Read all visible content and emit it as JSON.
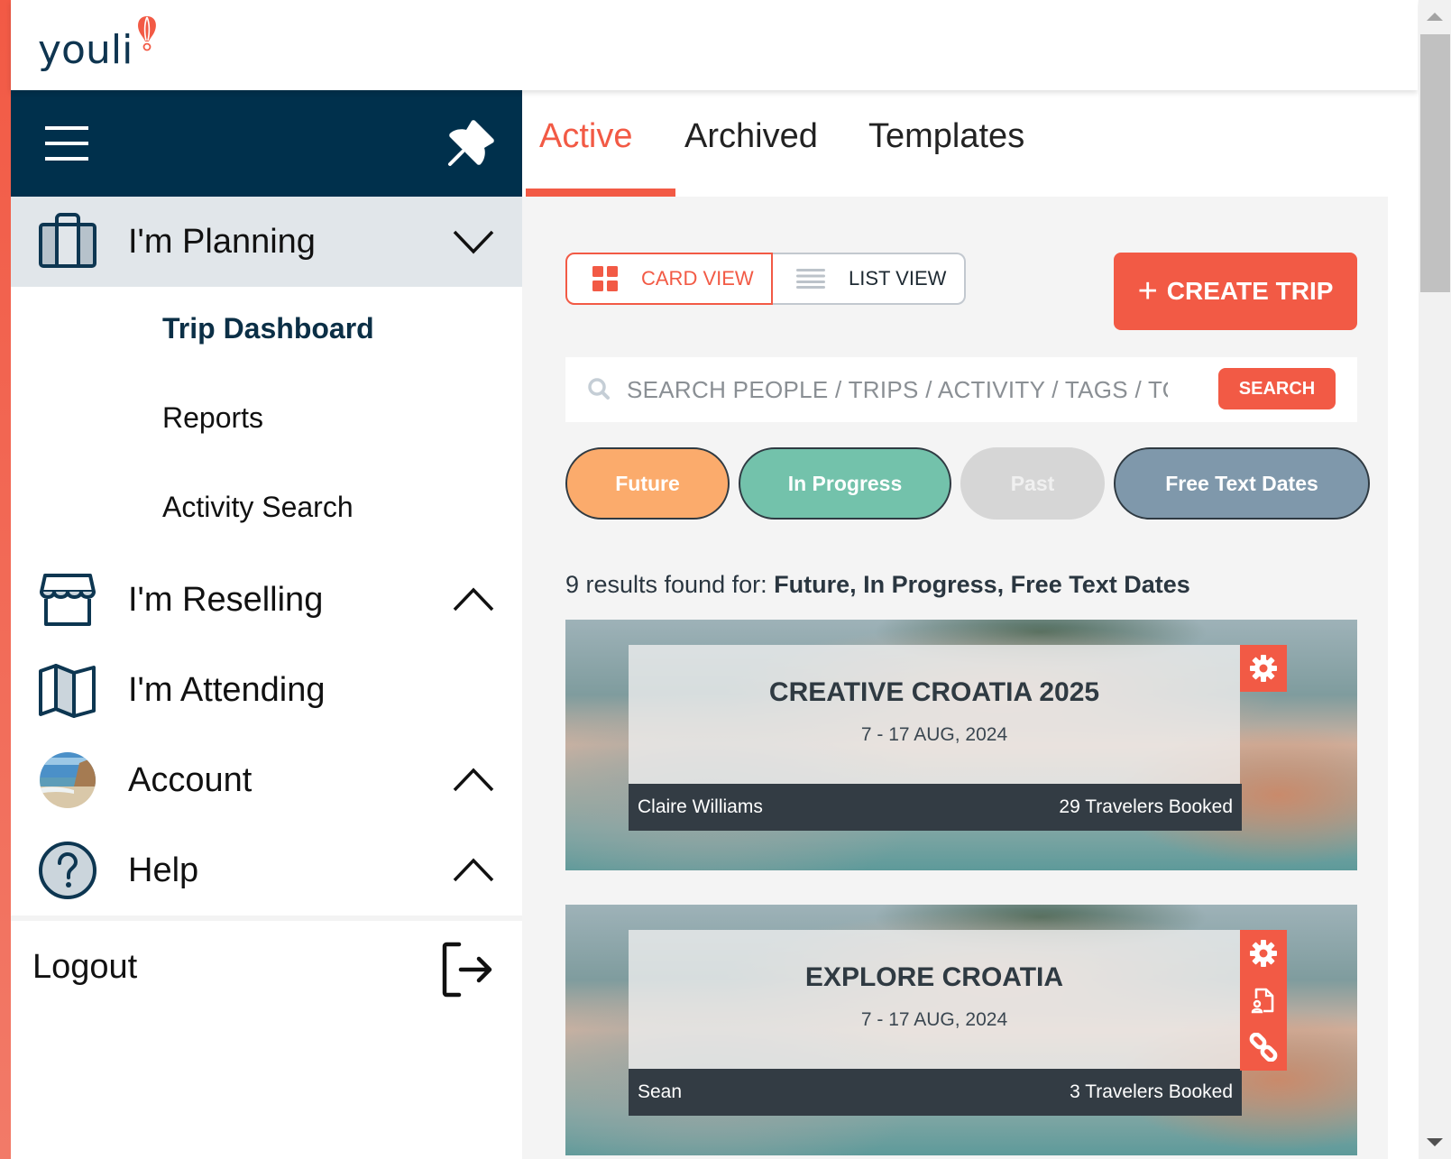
{
  "app": {
    "logo_text": "youli"
  },
  "sidebar": {
    "groups": [
      {
        "label": "I'm Planning",
        "icon": "suitcase-icon",
        "state": "expanded"
      },
      {
        "label": "I'm Reselling",
        "icon": "storefront-icon",
        "state": "collapsed"
      },
      {
        "label": "I'm Attending",
        "icon": "map-icon",
        "state": "none"
      },
      {
        "label": "Account",
        "icon": "avatar",
        "state": "collapsed"
      },
      {
        "label": "Help",
        "icon": "question-circle-icon",
        "state": "collapsed"
      }
    ],
    "planning_items": [
      {
        "label": "Trip Dashboard",
        "current": true
      },
      {
        "label": "Reports"
      },
      {
        "label": "Activity Search"
      }
    ],
    "logout_label": "Logout"
  },
  "tabs": [
    {
      "label": "Active",
      "active": true
    },
    {
      "label": "Archived"
    },
    {
      "label": "Templates"
    }
  ],
  "toolbar": {
    "card_view_label": "CARD VIEW",
    "list_view_label": "LIST VIEW",
    "selected_view": "card",
    "create_trip_label": "CREATE TRIP"
  },
  "search": {
    "placeholder": "SEARCH PEOPLE / TRIPS / ACTIVITY / TAGS / TO",
    "value": "",
    "button_label": "SEARCH"
  },
  "filters": [
    {
      "label": "Future",
      "active": true,
      "color": "#fbab6c"
    },
    {
      "label": "In Progress",
      "active": true,
      "color": "#73c2ab"
    },
    {
      "label": "Past",
      "active": false,
      "color": "#d6d6d6"
    },
    {
      "label": "Free Text Dates",
      "active": true,
      "color": "#7f98ab"
    }
  ],
  "results": {
    "prefix": "9 results found for: ",
    "terms": "Future, In Progress, Free Text Dates"
  },
  "trips": [
    {
      "title": "CREATIVE CROATIA 2025",
      "dates": "7 - 17 AUG, 2024",
      "organizer": "Claire Williams",
      "travelers": "29 Travelers Booked",
      "actions": [
        "gear-icon"
      ]
    },
    {
      "title": "EXPLORE CROATIA",
      "dates": "7 - 17 AUG, 2024",
      "organizer": "Sean",
      "travelers": "3 Travelers Booked",
      "actions": [
        "gear-icon",
        "document-user-icon",
        "link-icon"
      ]
    }
  ],
  "colors": {
    "accent": "#f25a45",
    "navy": "#00304c",
    "footer": "#333c44"
  }
}
